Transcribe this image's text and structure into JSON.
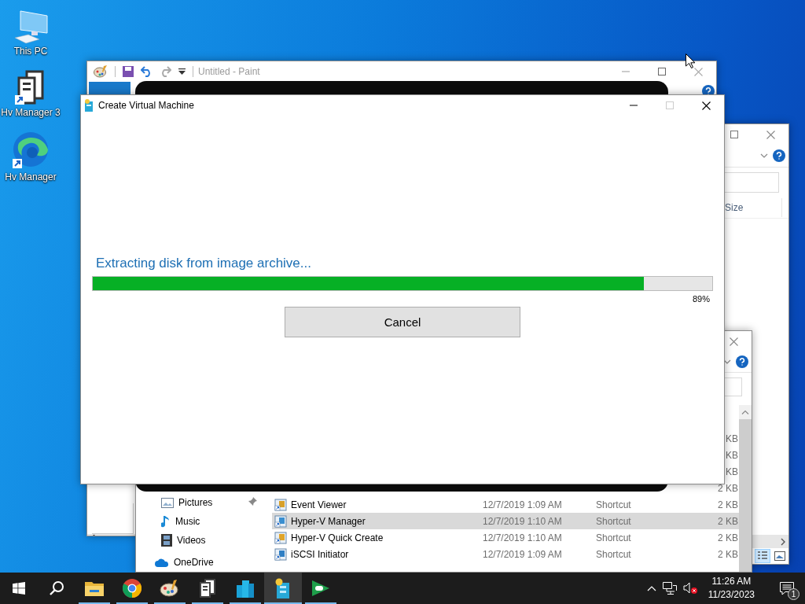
{
  "desktop_icons": [
    {
      "label": "This PC",
      "kind": "pc"
    },
    {
      "label": "Hv Manager 3",
      "kind": "server"
    },
    {
      "label": "Hv Manager",
      "kind": "edge"
    }
  ],
  "paint_window": {
    "title": "Untitled - Paint"
  },
  "explorer_back": {
    "size_header": "Size"
  },
  "explorer_front": {
    "nav_items": [
      {
        "label": "Pictures",
        "kind": "pictures",
        "pinned": true
      },
      {
        "label": "Music",
        "kind": "music",
        "pinned": false
      },
      {
        "label": "Videos",
        "kind": "videos",
        "pinned": false
      },
      {
        "label": "OneDrive",
        "kind": "onedrive",
        "pinned": false
      }
    ],
    "size_tails": [
      "KB",
      "KB",
      "KB",
      "2 KB"
    ],
    "rows": [
      {
        "name": "Event Viewer",
        "date": "12/7/2019 1:09 AM",
        "type": "Shortcut",
        "size": "2 KB",
        "selected": false
      },
      {
        "name": "Hyper-V Manager",
        "date": "12/7/2019 1:10 AM",
        "type": "Shortcut",
        "size": "2 KB",
        "selected": true
      },
      {
        "name": "Hyper-V Quick Create",
        "date": "12/7/2019 1:10 AM",
        "type": "Shortcut",
        "size": "2 KB",
        "selected": false
      },
      {
        "name": "iSCSI Initiator",
        "date": "12/7/2019 1:09 AM",
        "type": "Shortcut",
        "size": "2 KB",
        "selected": false
      }
    ]
  },
  "dialog": {
    "title": "Create Virtual Machine",
    "status": "Extracting disk from image archive...",
    "level": 0.89,
    "percent": "89%",
    "cancel": "Cancel"
  },
  "taskbar": {
    "apps": [
      {
        "kind": "explorer",
        "selected": false
      },
      {
        "kind": "chrome",
        "selected": false
      },
      {
        "kind": "paint",
        "selected": false
      },
      {
        "kind": "server",
        "selected": false
      },
      {
        "kind": "buildings",
        "selected": false
      },
      {
        "kind": "vm",
        "selected": true
      },
      {
        "kind": "game",
        "selected": false
      }
    ],
    "time": "11:26 AM",
    "date": "11/23/2023",
    "notifications": "1"
  }
}
